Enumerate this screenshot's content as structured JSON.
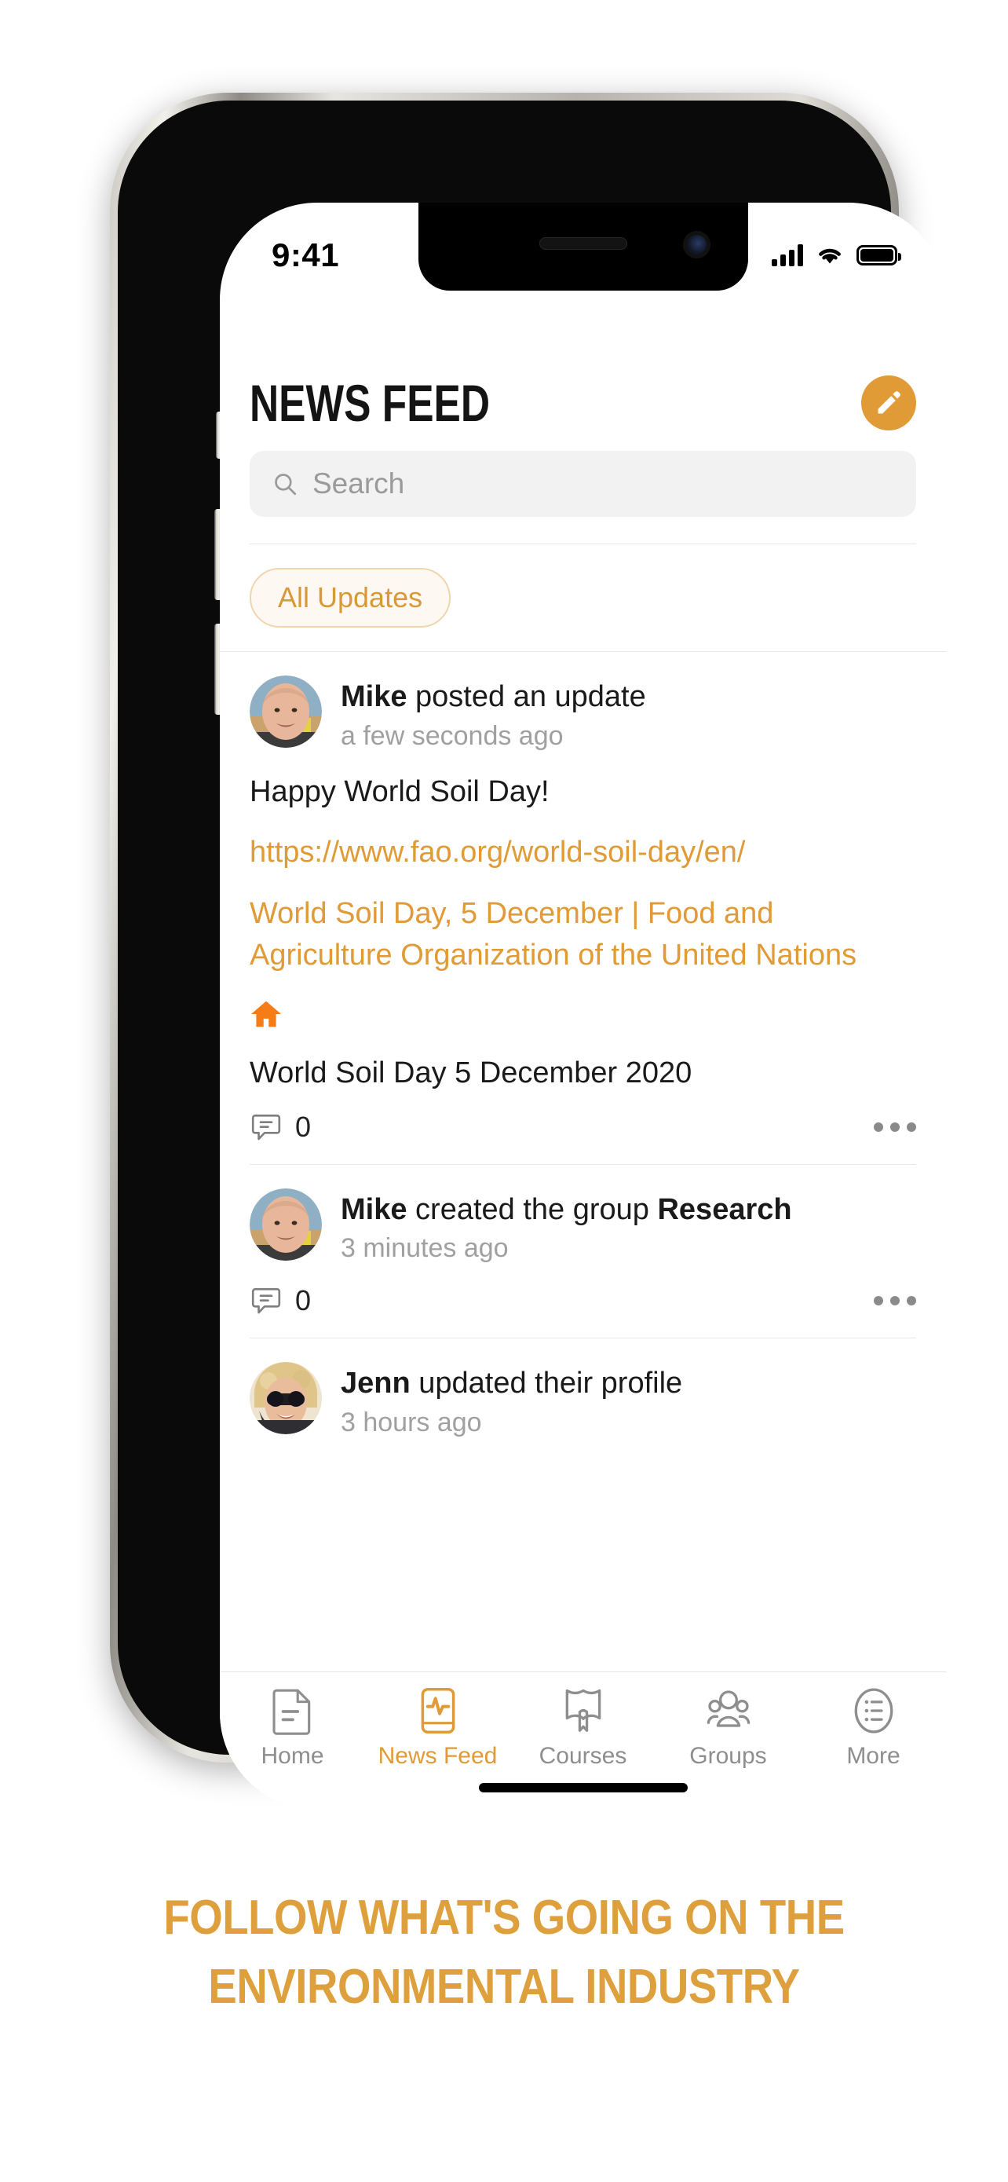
{
  "colors": {
    "accent": "#e09a36",
    "accent_text": "#dda03c",
    "muted_text": "#a0a0a0",
    "chip_bg": "#fdf8f1",
    "chip_border": "#f0d5ae",
    "search_bg": "#f2f2f2",
    "home_icon_orange": "#f57c16"
  },
  "status_bar": {
    "time": "9:41",
    "signal_icon": "cellular-signal-icon",
    "wifi_icon": "wifi-icon",
    "battery_icon": "battery-full-icon"
  },
  "header": {
    "title": "NEWS FEED",
    "compose_button": {
      "icon": "pencil-edit-icon",
      "label": "Compose"
    }
  },
  "search": {
    "placeholder": "Search",
    "value": "",
    "icon": "search-icon"
  },
  "filters": {
    "chips": [
      {
        "label": "All Updates",
        "active": true
      }
    ]
  },
  "feed": {
    "posts": [
      {
        "author": "Mike",
        "action": " posted an update",
        "time": "a few seconds ago",
        "avatar": "avatar-mike",
        "text": "Happy World Soil Day!",
        "link": "https://www.fao.org/world-soil-day/en/",
        "embed_title": "World Soil Day, 5 December | Food and Agriculture Organization of the United Nations",
        "embed_icon": "home-icon",
        "caption": "World Soil Day 5 December 2020",
        "comment_count": "0",
        "comment_icon": "comment-bubble-icon",
        "more_icon": "more-horizontal-icon"
      },
      {
        "author": "Mike",
        "action": " created the group ",
        "action_target": "Research",
        "time": "3 minutes ago",
        "avatar": "avatar-mike",
        "comment_count": "0",
        "comment_icon": "comment-bubble-icon",
        "more_icon": "more-horizontal-icon"
      },
      {
        "author": "Jenn",
        "action": " updated their profile",
        "time": "3 hours ago",
        "avatar": "avatar-jenn"
      }
    ]
  },
  "tabbar": {
    "tabs": [
      {
        "label": "Home",
        "icon": "document-page-icon",
        "active": false
      },
      {
        "label": "News Feed",
        "icon": "news-pulse-icon",
        "active": true
      },
      {
        "label": "Courses",
        "icon": "open-book-icon",
        "active": false
      },
      {
        "label": "Groups",
        "icon": "people-group-icon",
        "active": false
      },
      {
        "label": "More",
        "icon": "list-menu-icon",
        "active": false
      }
    ]
  },
  "caption": {
    "line1": "FOLLOW WHAT'S GOING ON THE",
    "line2": "ENVIRONMENTAL INDUSTRY"
  }
}
